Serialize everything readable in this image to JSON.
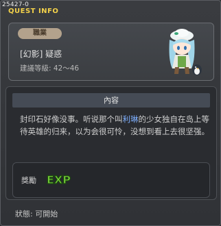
{
  "window": {
    "quest_id": "25427-0",
    "title": "QUEST INFO"
  },
  "job": {
    "badge": "職業",
    "name": "[幻影] 疑惑",
    "level": "建議等級: 42～46"
  },
  "content": {
    "header": "內容",
    "text_before": "封印石好像没事。听说那个叫",
    "highlight": "利琳",
    "text_after": "的少女独自在岛上等待英雄的归来，以为会很可怜，没想到看上去很坚强。"
  },
  "reward": {
    "label": "獎勵",
    "exp_text": "EXP"
  },
  "status": {
    "text": "狀態: 可開始"
  },
  "icons": {
    "avatar": "character-avatar-icon",
    "exp": "exp-reward-icon"
  },
  "colors": {
    "title": "#f4d24a",
    "highlight": "#7fb0ff",
    "badge": "#b3a28c",
    "exp_fill": "#7ad43a"
  }
}
